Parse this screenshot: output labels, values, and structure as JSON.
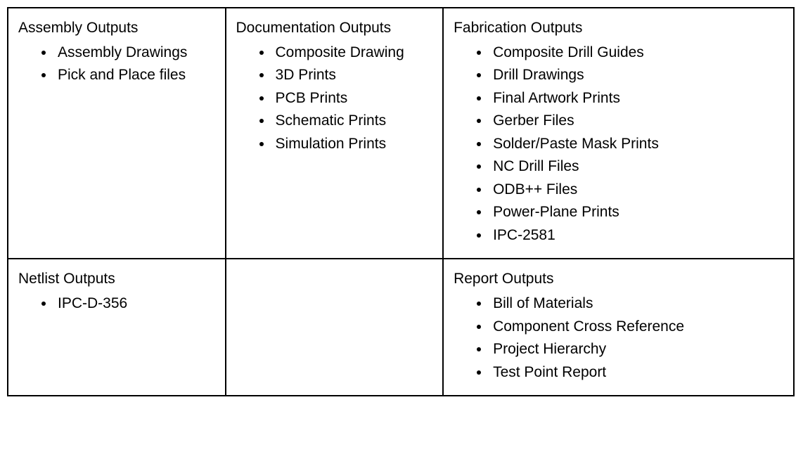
{
  "cells": {
    "assembly": {
      "heading": "Assembly Outputs",
      "items": [
        "Assembly Drawings",
        "Pick and Place files"
      ]
    },
    "documentation": {
      "heading": "Documentation Outputs",
      "items": [
        "Composite Drawing",
        "3D Prints",
        "PCB Prints",
        "Schematic Prints",
        "Simulation Prints"
      ]
    },
    "fabrication": {
      "heading": "Fabrication Outputs",
      "items": [
        "Composite Drill Guides",
        "Drill Drawings",
        "Final Artwork Prints",
        "Gerber Files",
        "Solder/Paste Mask Prints",
        "NC Drill Files",
        "ODB++ Files",
        "Power-Plane Prints",
        "IPC-2581"
      ]
    },
    "netlist": {
      "heading": "Netlist Outputs",
      "items": [
        "IPC-D-356"
      ]
    },
    "report": {
      "heading": "Report Outputs",
      "items": [
        "Bill of Materials",
        "Component Cross Reference",
        "Project Hierarchy",
        "Test Point Report"
      ]
    }
  }
}
